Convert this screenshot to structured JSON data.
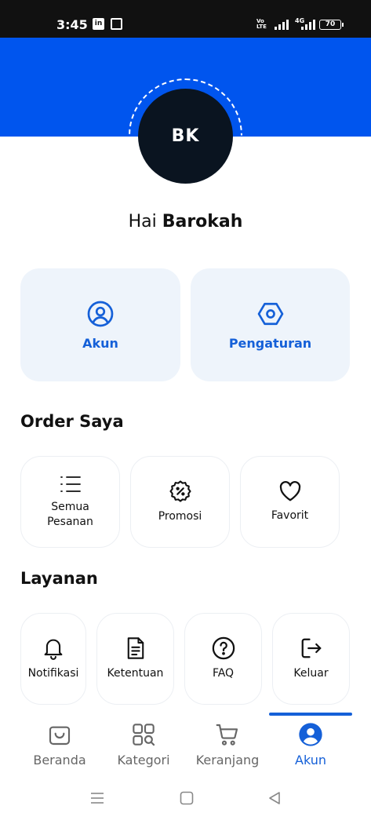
{
  "status_bar": {
    "time": "3:45",
    "linkedin_badge": "in",
    "network_type": "4G",
    "volte": "VoLTE",
    "battery": "70"
  },
  "profile": {
    "initials": "BK",
    "greeting_prefix": "Hai",
    "name": "Barokah"
  },
  "quick_cards": {
    "akun": "Akun",
    "pengaturan": "Pengaturan"
  },
  "order_section": {
    "title": "Order Saya",
    "items": [
      {
        "label": "Semua\nPesanan",
        "icon": "list-icon"
      },
      {
        "label": "Promosi",
        "icon": "promo-badge-icon"
      },
      {
        "label": "Favorit",
        "icon": "heart-icon"
      }
    ]
  },
  "services_section": {
    "title": "Layanan",
    "items": [
      {
        "label": "Notifikasi",
        "icon": "bell-icon"
      },
      {
        "label": "Ketentuan",
        "icon": "document-icon"
      },
      {
        "label": "FAQ",
        "icon": "question-icon"
      },
      {
        "label": "Keluar",
        "icon": "logout-icon"
      }
    ]
  },
  "bottom_nav": {
    "active": "akun",
    "items": [
      {
        "label": "Beranda",
        "icon": "home-bag-icon"
      },
      {
        "label": "Kategori",
        "icon": "category-grid-icon"
      },
      {
        "label": "Keranjang",
        "icon": "cart-icon"
      },
      {
        "label": "Akun",
        "icon": "account-icon"
      }
    ]
  },
  "colors": {
    "brand_blue": "#0055ee",
    "accent_blue": "#1560d8",
    "card_bg": "#eef4fb",
    "avatar_bg": "#0a1420"
  }
}
